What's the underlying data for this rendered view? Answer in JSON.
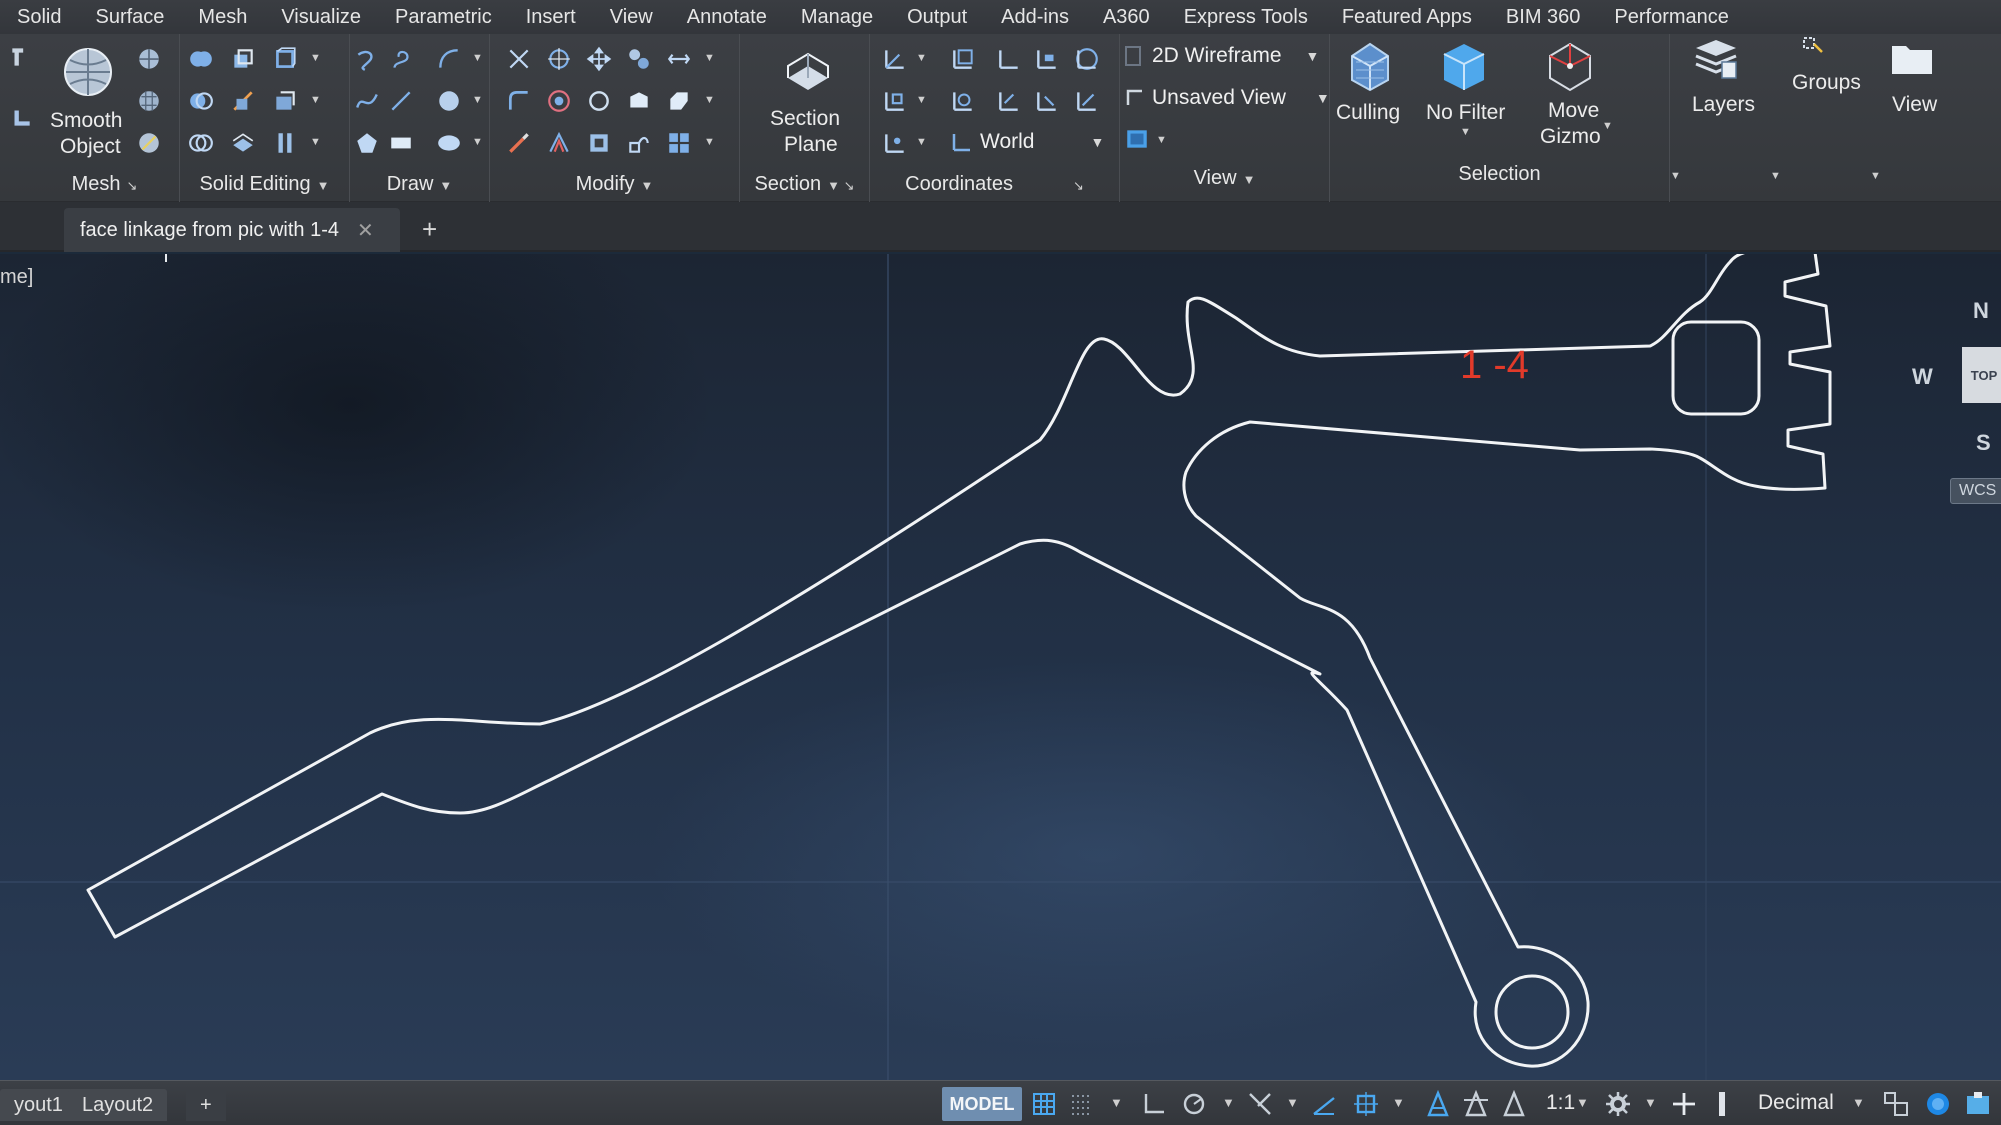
{
  "menu": [
    "Solid",
    "Surface",
    "Mesh",
    "Visualize",
    "Parametric",
    "Insert",
    "View",
    "Annotate",
    "Manage",
    "Output",
    "Add-ins",
    "A360",
    "Express Tools",
    "Featured Apps",
    "BIM 360",
    "Performance"
  ],
  "ribbon": {
    "mesh": {
      "title": "Mesh",
      "smooth_line1": "Smooth",
      "smooth_line2": "Object"
    },
    "solid_editing": {
      "title": "Solid Editing"
    },
    "draw": {
      "title": "Draw"
    },
    "modify": {
      "title": "Modify"
    },
    "section": {
      "title": "Section",
      "plane_line1": "Section",
      "plane_line2": "Plane"
    },
    "coordinates": {
      "title": "Coordinates",
      "ucs_value": "World"
    },
    "view": {
      "title": "View",
      "visual_style": "2D Wireframe",
      "named_view": "Unsaved View"
    },
    "selection": {
      "title": "Selection",
      "culling": "Culling",
      "no_filter": "No Filter",
      "gizmo_line1": "Move",
      "gizmo_line2": "Gizmo"
    },
    "layers": {
      "label": "Layers"
    },
    "groups": {
      "label": "Groups"
    },
    "view_btn": {
      "label": "View"
    }
  },
  "document_tab": {
    "title": "face linkage from pic with 1-4",
    "close": "✕",
    "new": "+"
  },
  "viewport": {
    "label": "me]",
    "annotation": "1 -4",
    "annotation_color": "#e23a2a",
    "line_color": "#f2f4f6",
    "viewcube": {
      "north": "N",
      "west": "W",
      "south": "S",
      "top": "TOP",
      "wcs": "WCS"
    }
  },
  "status": {
    "layouts": [
      "yout1",
      "Layout2"
    ],
    "add_layout": "+",
    "model": "MODEL",
    "scale": "1:1",
    "units": "Decimal"
  },
  "icons": [
    "smooth-object-icon",
    "section-plane-icon",
    "culling-icon",
    "no-filter-icon",
    "move-gizmo-icon",
    "layers-icon",
    "groups-icon",
    "view-icon",
    "crosshair-icon"
  ]
}
